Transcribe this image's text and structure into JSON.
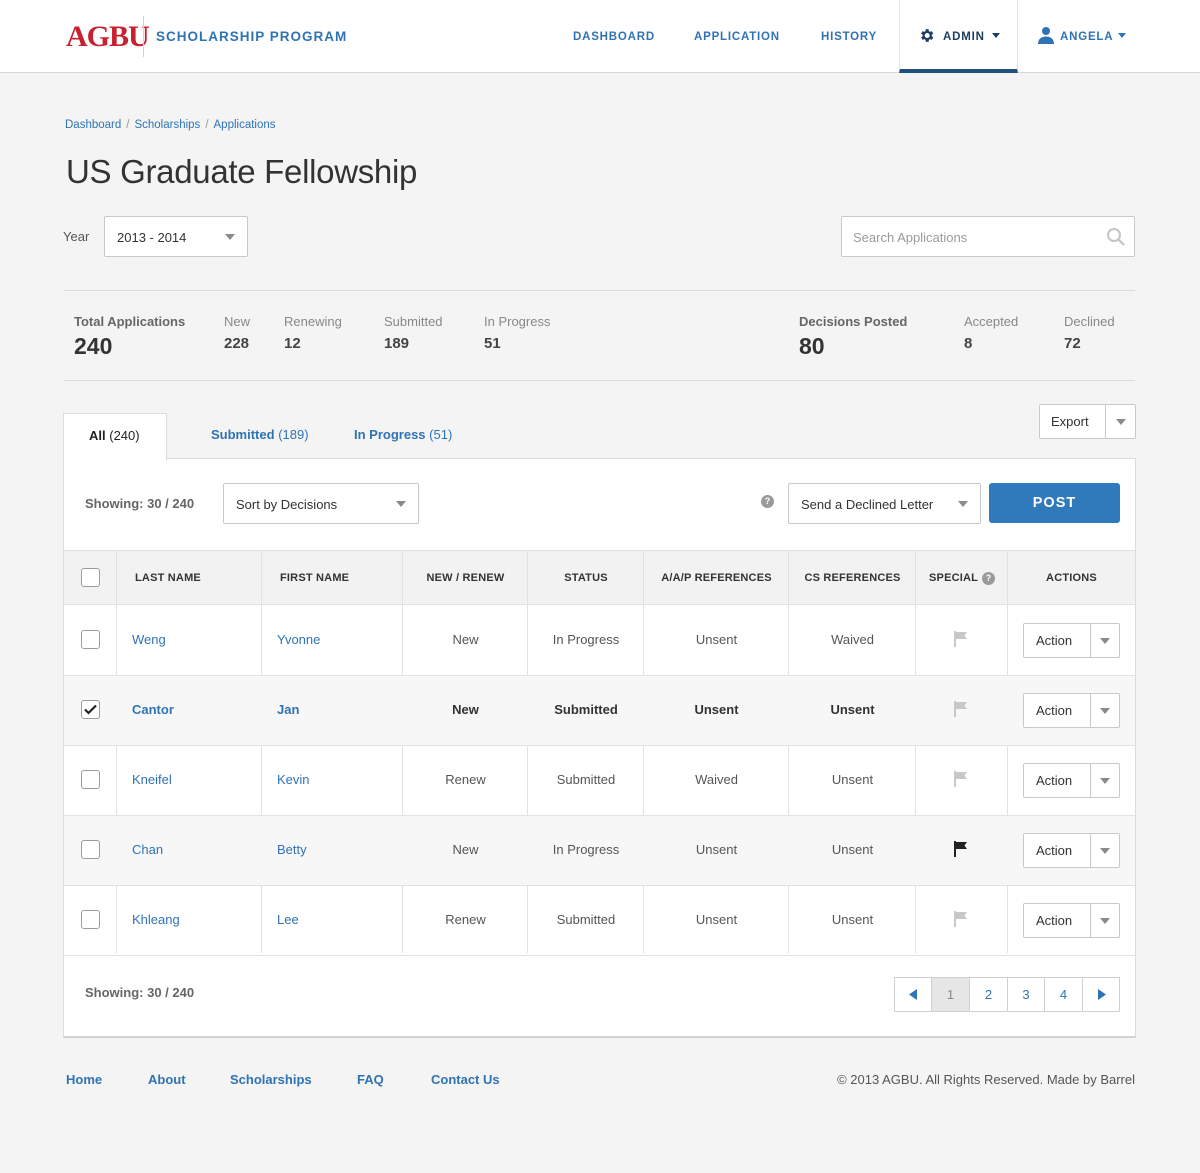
{
  "brand": {
    "logo": "AGBU",
    "program": "SCHOLARSHIP PROGRAM",
    "logo_color": "#c8202f",
    "accent": "#2f73b5"
  },
  "nav": {
    "dashboard": "DASHBOARD",
    "application": "APPLICATION",
    "history": "HISTORY",
    "admin": "ADMIN",
    "user": "ANGELA"
  },
  "breadcrumb": [
    "Dashboard",
    "Scholarships",
    "Applications"
  ],
  "page_title": "US Graduate Fellowship",
  "filters": {
    "year_label": "Year",
    "year_value": "2013 - 2014",
    "search_placeholder": "Search Applications"
  },
  "stats": {
    "total": {
      "label": "Total Applications",
      "value": "240"
    },
    "new": {
      "label": "New",
      "value": "228"
    },
    "renewing": {
      "label": "Renewing",
      "value": "12"
    },
    "submitted": {
      "label": "Submitted",
      "value": "189"
    },
    "in_progress": {
      "label": "In Progress",
      "value": "51"
    },
    "decisions": {
      "label": "Decisions Posted",
      "value": "80"
    },
    "accepted": {
      "label": "Accepted",
      "value": "8"
    },
    "declined": {
      "label": "Declined",
      "value": "72"
    }
  },
  "tabs": [
    {
      "label": "All",
      "count": "(240)"
    },
    {
      "label": "Submitted",
      "count": "(189)"
    },
    {
      "label": "In Progress",
      "count": "(51)"
    }
  ],
  "export_label": "Export",
  "toolbar": {
    "showing": "Showing: 30 / 240",
    "sort_value": "Sort by Decisions",
    "help": "?",
    "letter_value": "Send a Declined Letter",
    "post_label": "POST"
  },
  "table": {
    "headers": [
      "LAST NAME",
      "FIRST NAME",
      "NEW / RENEW",
      "STATUS",
      "A/A/P REFERENCES",
      "CS REFERENCES",
      "SPECIAL",
      "ACTIONS"
    ],
    "rows": [
      {
        "last": "Weng",
        "first": "Yvonne",
        "type": "New",
        "status": "In Progress",
        "aap": "Unsent",
        "cs": "Waived",
        "checked": false,
        "flagged": false,
        "action": "Action"
      },
      {
        "last": "Cantor",
        "first": "Jan",
        "type": "New",
        "status": "Submitted",
        "aap": "Unsent",
        "cs": "Unsent",
        "checked": true,
        "flagged": false,
        "action": "Action"
      },
      {
        "last": "Kneifel",
        "first": "Kevin",
        "type": "Renew",
        "status": "Submitted",
        "aap": "Waived",
        "cs": "Unsent",
        "checked": false,
        "flagged": false,
        "action": "Action"
      },
      {
        "last": "Chan",
        "first": "Betty",
        "type": "New",
        "status": "In Progress",
        "aap": "Unsent",
        "cs": "Unsent",
        "checked": false,
        "flagged": true,
        "action": "Action"
      },
      {
        "last": "Khleang",
        "first": "Lee",
        "type": "Renew",
        "status": "Submitted",
        "aap": "Unsent",
        "cs": "Unsent",
        "checked": false,
        "flagged": false,
        "action": "Action"
      }
    ]
  },
  "footer_showing": "Showing: 30 / 240",
  "pagination": {
    "pages": [
      "1",
      "2",
      "3",
      "4"
    ],
    "current": "1"
  },
  "footer": {
    "links": [
      "Home",
      "About",
      "Scholarships",
      "FAQ",
      "Contact Us"
    ],
    "copyright": "© 2013 AGBU. All Rights Reserved. Made by Barrel"
  }
}
